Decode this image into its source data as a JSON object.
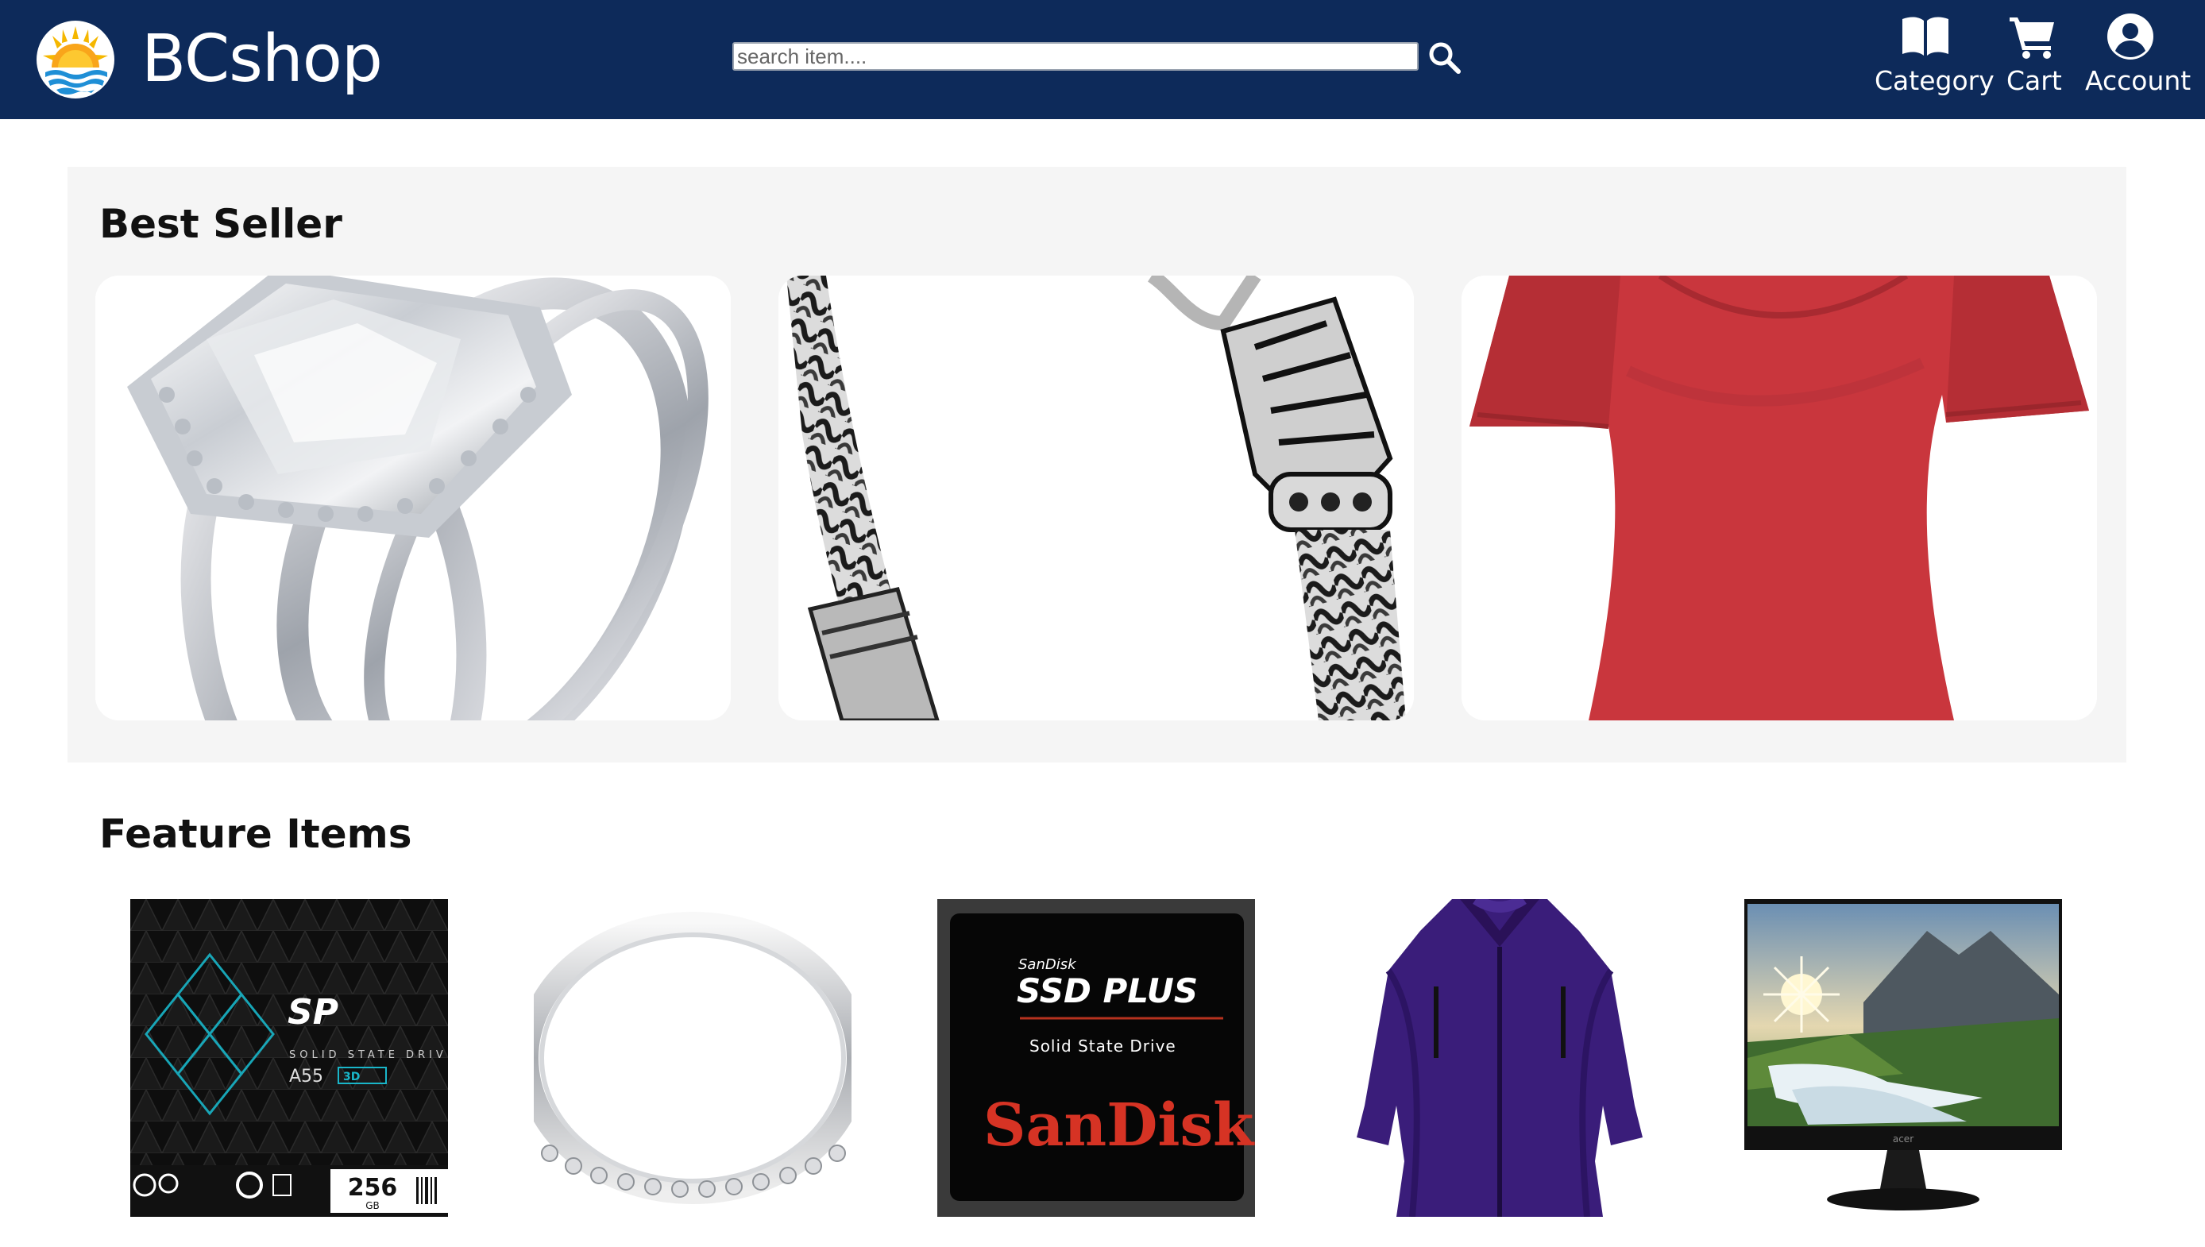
{
  "header": {
    "brand": "BCshop",
    "search": {
      "placeholder": "search item....",
      "value": ""
    },
    "nav": {
      "category_label": "Category",
      "cart_label": "Cart",
      "account_label": "Account"
    }
  },
  "best_seller": {
    "title": "Best Seller",
    "products": [
      {
        "image": "cushion-cut-diamond-ring-set"
      },
      {
        "image": "silver-chain-bracelet"
      },
      {
        "image": "red-womens-tshirt"
      }
    ]
  },
  "feature_items": {
    "title": "Feature Items",
    "products": [
      {
        "image": "silicon-power-ssd-box",
        "box_text": {
          "brand": "SP",
          "line1": "SOLID STATE DRIVE",
          "model": "A55",
          "badge": "3D",
          "capacity": "256",
          "unit": "GB"
        }
      },
      {
        "image": "silver-eternity-band-ring"
      },
      {
        "image": "sandisk-ssd-plus-box",
        "box_text": {
          "maker": "SanDisk",
          "product": "SSD PLUS",
          "subtitle": "Solid State Drive",
          "logo": "SanDisk"
        }
      },
      {
        "image": "purple-womens-jacket"
      },
      {
        "image": "acer-monitor-waterfall-landscape",
        "box_text": {
          "logo": "acer"
        }
      }
    ]
  },
  "colors": {
    "header_bg": "#0d2a5a",
    "section_bg": "#f5f5f5",
    "text_dark": "#111111",
    "white": "#ffffff"
  },
  "icons": {
    "logo": "sun-over-waves-logo",
    "search": "magnifier-icon",
    "category": "open-book-icon",
    "cart": "shopping-cart-icon",
    "account": "user-circle-icon",
    "next": "chevron-right-icon"
  }
}
